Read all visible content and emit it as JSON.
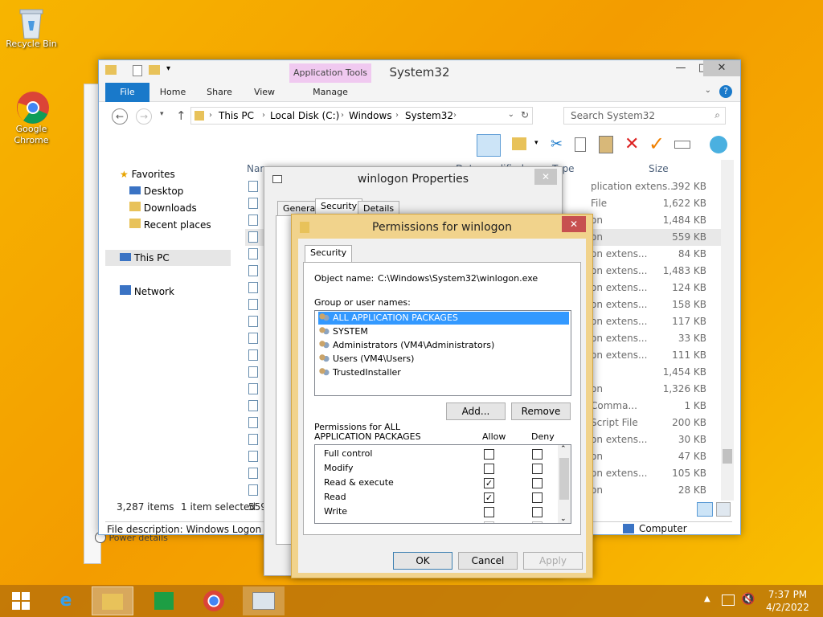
{
  "desktop": {
    "recycle_bin": "Recycle Bin",
    "chrome": "Google Chrome"
  },
  "explorer": {
    "title": "System32",
    "app_tools": "Application Tools",
    "tabs": [
      "File",
      "Home",
      "Share",
      "View",
      "Manage"
    ],
    "breadcrumb": [
      "This PC",
      "Local Disk (C:)",
      "Windows",
      "System32"
    ],
    "search_placeholder": "Search System32",
    "nav": {
      "favorites": "Favorites",
      "desktop": "Desktop",
      "downloads": "Downloads",
      "recent": "Recent places",
      "thispc": "This PC",
      "network": "Network"
    },
    "columns": {
      "name": "Name",
      "date": "Date modified",
      "type": "Type",
      "size": "Size"
    },
    "rows": [
      {
        "type": "plication extens...",
        "size": "392 KB"
      },
      {
        "type": "File",
        "size": "1,622 KB"
      },
      {
        "type": "on",
        "size": "1,484 KB"
      },
      {
        "type": "on",
        "size": "559 KB"
      },
      {
        "type": "on extens...",
        "size": "84 KB"
      },
      {
        "type": "on extens...",
        "size": "1,483 KB"
      },
      {
        "type": "on extens...",
        "size": "124 KB"
      },
      {
        "type": "on extens...",
        "size": "158 KB"
      },
      {
        "type": "on extens...",
        "size": "117 KB"
      },
      {
        "type": "on extens...",
        "size": "33 KB"
      },
      {
        "type": "on extens...",
        "size": "111 KB"
      },
      {
        "type": "",
        "size": "1,454 KB"
      },
      {
        "type": "on",
        "size": "1,326 KB"
      },
      {
        "type": "Comma...",
        "size": "1 KB"
      },
      {
        "type": "Script File",
        "size": "200 KB"
      },
      {
        "type": "on extens...",
        "size": "30 KB"
      },
      {
        "type": "on",
        "size": "47 KB"
      },
      {
        "type": "on extens...",
        "size": "105 KB"
      },
      {
        "type": "on",
        "size": "28 KB"
      }
    ],
    "status_count": "3,287 items",
    "status_selected": "1 item selected",
    "status_size": "559",
    "description": "File description: Windows Logon App",
    "computer": "Computer"
  },
  "props": {
    "title": "winlogon Properties",
    "tabs": [
      "General",
      "Security",
      "Details"
    ]
  },
  "perm": {
    "title": "Permissions for winlogon",
    "tab": "Security",
    "object_label": "Object name:",
    "object_value": "C:\\Windows\\System32\\winlogon.exe",
    "group_label": "Group or user names:",
    "users": [
      "ALL APPLICATION PACKAGES",
      "SYSTEM",
      "Administrators (VM4\\Administrators)",
      "Users (VM4\\Users)",
      "TrustedInstaller"
    ],
    "add": "Add...",
    "remove": "Remove",
    "perm_label_1": "Permissions for ALL",
    "perm_label_2": "APPLICATION PACKAGES",
    "allow": "Allow",
    "deny": "Deny",
    "permissions": [
      {
        "name": "Full control",
        "allow": false,
        "deny": false
      },
      {
        "name": "Modify",
        "allow": false,
        "deny": false
      },
      {
        "name": "Read & execute",
        "allow": true,
        "deny": false
      },
      {
        "name": "Read",
        "allow": true,
        "deny": false
      },
      {
        "name": "Write",
        "allow": false,
        "deny": false
      }
    ],
    "ok": "OK",
    "cancel": "Cancel",
    "apply": "Apply"
  },
  "props_behind": {
    "power": "Power details"
  },
  "tray": {
    "time": "7:37 PM",
    "date": "4/2/2022"
  }
}
